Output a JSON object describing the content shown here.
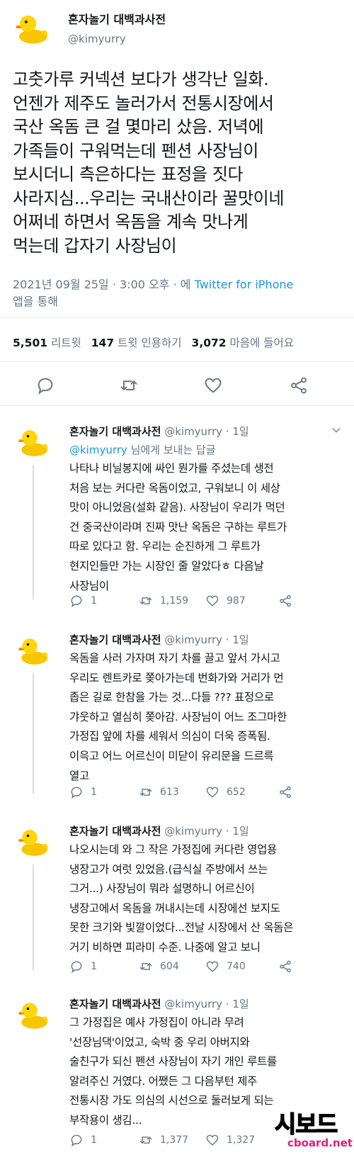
{
  "main_tweet": {
    "author_name": "혼자놀기 대백과사전",
    "author_handle": "@kimyurry",
    "text_lines": [
      "고춧가루 커넥션 보다가 생각난 일화.",
      "언젠가 제주도 놀러가서 전통시장에서",
      "국산 옥돔 큰 걸 몇마리 샀음. 저녁에",
      "가족들이 구워먹는데 펜션 사장님이",
      "보시더니 측은하다는 표정을 짓다",
      "사라지심...우리는 국내산이라 꿀맛이네",
      "어쩌네 하면서 옥돔을 계속 맛나게",
      "먹는데 갑자기 사장님이"
    ],
    "timestamp": "2021년 09월 25일 · 3:00 오후 · 에",
    "source": "Twitter for iPhone",
    "via": "앱을 통해",
    "retweets_count": "5,501",
    "retweets_label": "리트윗",
    "quotes_count": "147",
    "quotes_label": "트윗 인용하기",
    "likes_count": "3,072",
    "likes_label": "마음에 들어요"
  },
  "replies": [
    {
      "author_name": "혼자놀기 대백과사전",
      "author_handle": "@kimyurry",
      "time": "1일",
      "replying_to_handle": "@kimyurry",
      "replying_to_suffix": "님에게 보내는 답글",
      "text_lines": [
        "나타나 비닐봉지에 싸인 뭔가를 주셨는데 생전",
        "처음 보는 커다란 옥돔이었고, 구워보니 이 세상",
        "맛이 아니었음(설화 같음). 사장님이 우리가 먹던",
        "건 중국산이라며 진짜 맛난 옥돔은 구하는 루트가",
        "따로 있다고 함. 우리는 순진하게 그 루트가",
        "현지인들만 가는 시장인 줄 알았다ㅎ 다음날",
        "사장님이"
      ],
      "reply_count": "1",
      "retweet_count": "1,159",
      "like_count": "987"
    },
    {
      "author_name": "혼자놀기 대백과사전",
      "author_handle": "@kimyurry",
      "time": "1일",
      "text_lines": [
        "옥돔을 사러 가자며 자기 차를 끌고 앞서 가시고",
        "우리도 렌트카로 쫒아가는데 번화가와 거리가 먼",
        "좁은 길로 한참을 가는 것...다들 ??? 표정으로",
        "갸웃하고 열심히 쫒아감. 사장님이 어느 조그마한",
        "가정집 앞에 차를 세워서 의심이 더욱 증폭됨.",
        "이윽고 어느 어르신이 미닫이 유리문을 드르륵",
        "열고"
      ],
      "reply_count": "1",
      "retweet_count": "613",
      "like_count": "652"
    },
    {
      "author_name": "혼자놀기 대백과사전",
      "author_handle": "@kimyurry",
      "time": "1일",
      "text_lines": [
        "나오시는데 와 그 작은 가정집에 커다란 영업용",
        "냉장고가 여럿 있었음.(급식실 주방에서 쓰는",
        "그거...) 사장님이 뭐라 설명하니 어르신이",
        "냉장고에서 옥돔을 꺼내시는데 시장에선 보지도",
        "못한 크기와 빛깔이었다...전날 시장에서 산 옥돔은",
        "거기 비하면 피라미 수준. 나중에 알고 보니"
      ],
      "reply_count": "1",
      "retweet_count": "604",
      "like_count": "740"
    },
    {
      "author_name": "혼자놀기 대백과사전",
      "author_handle": "@kimyurry",
      "time": "1일",
      "text_lines": [
        "그 가정집은 예사 가정집이 아니라 무려",
        "'선장님댁'이었고, 숙박 중 우리 아버지와",
        "술친구가 되신 펜션 사장님이 자기 개인 루트를",
        "알려주신 거였다. 어쨌든 그 다음부턴 제주",
        "전통시장 가도 의심의 시선으로 둘러보게 되는",
        "부작용이 생김..."
      ],
      "reply_count": "1",
      "retweet_count": "1,377",
      "like_count": "1,327"
    }
  ],
  "watermark": {
    "brand": "시보드",
    "site": "cboard.net"
  },
  "colors": {
    "text": "#14171a",
    "secondary": "#657786",
    "link": "#1b95e0",
    "divider": "#e6ecf0",
    "watermark": "#e8197d"
  },
  "icons": {
    "avatar": "rubber-duck",
    "reply": "reply-icon",
    "retweet": "retweet-icon",
    "like": "heart-icon",
    "share": "share-icon",
    "more": "chevron-down-icon"
  }
}
